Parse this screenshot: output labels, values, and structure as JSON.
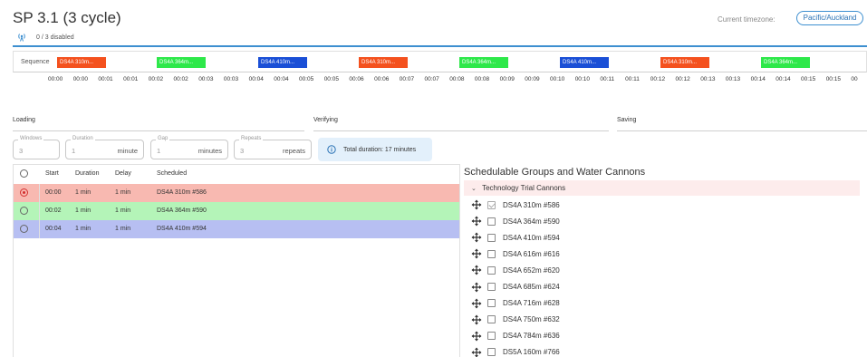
{
  "header": {
    "title": "SP 3.1 (3 cycle)",
    "disabled_text": "0 / 3 disabled",
    "timezone_label": "Current timezone:",
    "timezone_value": "Pacific/Auckland"
  },
  "sequence": {
    "label": "Sequence",
    "blocks": [
      {
        "label": "DS4A 310m...",
        "color": "#f4511e"
      },
      {
        "label": "DS4A 364m...",
        "color": "#2ee84a"
      },
      {
        "label": "DS4A 410m...",
        "color": "#1a4fd6"
      },
      {
        "label": "DS4A 310m...",
        "color": "#f4511e"
      },
      {
        "label": "DS4A 364m...",
        "color": "#2ee84a"
      },
      {
        "label": "DS4A 410m...",
        "color": "#1a4fd6"
      },
      {
        "label": "DS4A 310m...",
        "color": "#f4511e"
      },
      {
        "label": "DS4A 364m...",
        "color": "#2ee84a"
      }
    ],
    "times": [
      "00:00",
      "00:00",
      "00:01",
      "00:01",
      "00:02",
      "00:02",
      "00:03",
      "00:03",
      "00:04",
      "00:04",
      "00:05",
      "00:05",
      "00:06",
      "00:06",
      "00:07",
      "00:07",
      "00:08",
      "00:08",
      "00:09",
      "00:09",
      "00:10",
      "00:10",
      "00:11",
      "00:11",
      "00:12",
      "00:12",
      "00:13",
      "00:13",
      "00:14",
      "00:14",
      "00:15",
      "00:15",
      "00"
    ]
  },
  "sections": {
    "loading": "Loading",
    "verifying": "Verifying",
    "saving": "Saving"
  },
  "fields": {
    "windows": {
      "label": "Windows",
      "value": "3",
      "unit": ""
    },
    "duration": {
      "label": "Duration",
      "value": "1",
      "unit": "minute"
    },
    "gap": {
      "label": "Gap",
      "value": "1",
      "unit": "minutes"
    },
    "repeats": {
      "label": "Repeats",
      "value": "3",
      "unit": "repeats"
    }
  },
  "total_duration": "Total duration: 17 minutes",
  "table": {
    "headers": {
      "start": "Start",
      "duration": "Duration",
      "delay": "Delay",
      "scheduled": "Scheduled"
    },
    "rows": [
      {
        "start": "00:00",
        "duration": "1 min",
        "delay": "1 min",
        "scheduled": "DS4A 310m #586",
        "bg": "#f8b9b1",
        "selected": true
      },
      {
        "start": "00:02",
        "duration": "1 min",
        "delay": "1 min",
        "scheduled": "DS4A 364m #590",
        "bg": "#b4f4b8",
        "selected": false
      },
      {
        "start": "00:04",
        "duration": "1 min",
        "delay": "1 min",
        "scheduled": "DS4A 410m #594",
        "bg": "#b7bff2",
        "selected": false
      }
    ]
  },
  "right_panel": {
    "title": "Schedulable Groups and Water Cannons",
    "group": "Technology Trial Cannons",
    "cannons": [
      {
        "label": "DS4A 310m #586",
        "checked": true
      },
      {
        "label": "DS4A 364m #590",
        "checked": false
      },
      {
        "label": "DS4A 410m #594",
        "checked": false
      },
      {
        "label": "DS4A 616m #616",
        "checked": false
      },
      {
        "label": "DS4A 652m #620",
        "checked": false
      },
      {
        "label": "DS4A 685m #624",
        "checked": false
      },
      {
        "label": "DS4A 716m #628",
        "checked": false
      },
      {
        "label": "DS4A 750m #632",
        "checked": false
      },
      {
        "label": "DS4A 784m #636",
        "checked": false
      },
      {
        "label": "DS5A 160m #766",
        "checked": false
      }
    ]
  }
}
